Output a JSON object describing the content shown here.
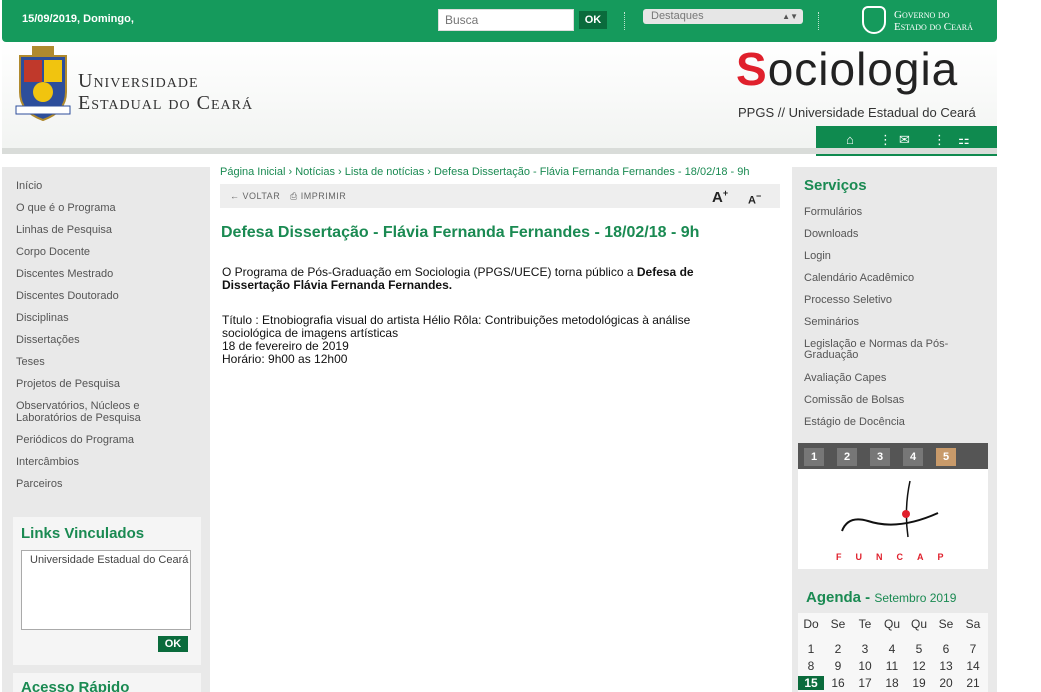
{
  "topbar": {
    "date": "15/09/2019, Domingo,",
    "search_placeholder": "Busca",
    "ok_label": "OK",
    "select_value": "Destaques",
    "gov_line1": "Governo do",
    "gov_line2": "Estado do Ceará"
  },
  "header": {
    "uni_line1": "Universidade",
    "uni_line2": "Estadual do Ceará",
    "site_s": "S",
    "site_rest": "ociologia",
    "site_sub": "PPGS // Universidade Estadual do Ceará",
    "nav_icons": [
      "home-icon",
      "mail-icon",
      "sitemap-icon"
    ]
  },
  "left_menu": {
    "items": [
      "Início",
      "O que é o Programa",
      "Linhas de Pesquisa",
      "Corpo Docente",
      "Discentes Mestrado",
      "Discentes Doutorado",
      "Disciplinas",
      "Dissertações",
      "Teses",
      "Projetos de Pesquisa",
      "Observatórios, Núcleos e",
      "Laboratórios de Pesquisa",
      "Periódicos do Programa",
      "Intercâmbios",
      "Parceiros"
    ],
    "links_title": "Links Vinculados",
    "links_option": "Universidade Estadual do Ceará",
    "links_ok": "OK",
    "acesso_title": "Acesso Rápido"
  },
  "content": {
    "breadcrumb": "Página Inicial › Notícias › Lista de notícias › Defesa Dissertação - Flávia Fernanda Fernandes - 18/02/18 - 9h",
    "back_label": "VOLTAR",
    "print_label": "IMPRIMIR",
    "font_up": "A",
    "font_down": "A",
    "title": "Defesa Dissertação - Flávia Fernanda Fernandes - 18/02/18 - 9h",
    "p1_normal": "O Programa de Pós-Graduação em Sociologia (PPGS/UECE) torna público a ",
    "p1_bold_a": "Defesa  de",
    "p1_bold_b": "Dissertação  Flávia Fernanda Fernandes.",
    "line_titulo_a": "Título : Etnobiografia visual do artista Hélio Rôla: Contribuições metodológicas à análise",
    "line_titulo_b": "sociológica de imagens artísticas",
    "line_data": "18 de fevereiro de 2019",
    "line_horario": "Horário:   9h00 as 12h00"
  },
  "right_menu": {
    "title": "Serviços",
    "items": [
      "Formulários",
      "Downloads",
      "Login",
      "Calendário Acadêmico",
      "Processo Seletivo",
      "Seminários",
      "Legislação e Normas da Pós-",
      "Graduação",
      "Avaliação Capes",
      "Comissão de Bolsas",
      "Estágio de Docência"
    ],
    "slider_numbers": [
      "1",
      "2",
      "3",
      "4",
      "5"
    ],
    "slider_active": "5",
    "funcap_text": "FUNCAP",
    "agenda_title": "Agenda - ",
    "agenda_month": "Setembro 2019",
    "weekdays": [
      "Do",
      "Se",
      "Te",
      "Qu",
      "Qu",
      "Se",
      "Sa"
    ],
    "week1": [
      "1",
      "2",
      "3",
      "4",
      "5",
      "6",
      "7"
    ],
    "week2": [
      "8",
      "9",
      "10",
      "11",
      "12",
      "13",
      "14"
    ],
    "week3": [
      "15",
      "16",
      "17",
      "18",
      "19",
      "20",
      "21"
    ],
    "today": "15"
  },
  "colors": {
    "brand_green": "#159a5c",
    "dark_green": "#0a6b3c",
    "accent_red": "#e0202c"
  }
}
